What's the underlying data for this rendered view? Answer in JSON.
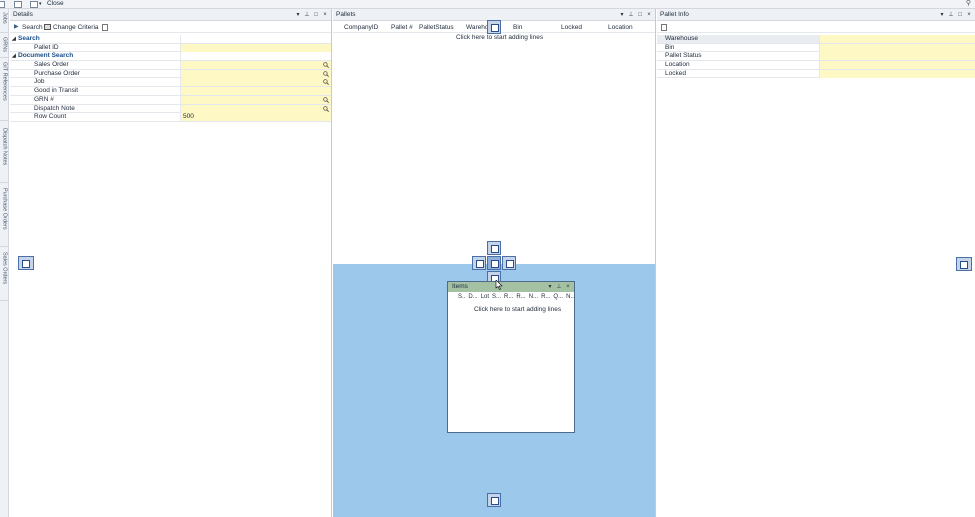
{
  "toolbar": {
    "close_label": "Close"
  },
  "side_tabs": [
    "Jobs",
    "GRNs",
    "GIT References",
    "Dispatch Notes",
    "Purchase Orders",
    "Sales Orders"
  ],
  "details": {
    "title": "Details",
    "search_label": "Search",
    "change_criteria_label": "Change Criteria",
    "cat_search": "Search",
    "cat_document": "Document Search",
    "rows": {
      "pallet_id": "Pallet ID",
      "sales_order": "Sales Order",
      "purchase_order": "Purchase Order",
      "job": "Job",
      "good_in_transit": "Good in Transit",
      "grn": "GRN #",
      "dispatch_note": "Dispatch Note",
      "row_count": "Row Count",
      "row_count_value": "500"
    }
  },
  "pallets": {
    "title": "Pallets",
    "columns": [
      "CompanyID",
      "Pallet #",
      "PalletStatus",
      "Wareho",
      "Bin",
      "Locked",
      "Location"
    ],
    "hint": "Click here to start adding lines"
  },
  "items": {
    "title": "Items",
    "columns": [
      "S..",
      "D...",
      "Lot",
      "S...",
      "R...",
      "R...",
      "N...",
      "R...",
      "Q...",
      "N..."
    ],
    "hint": "Click here to start adding lines"
  },
  "pallet_info": {
    "title": "Pallet Info",
    "rows": [
      "Warehouse",
      "Bin",
      "Pallet Status",
      "Location",
      "Locked"
    ]
  },
  "colors": {
    "dock_highlight": "#9cc8eb",
    "field_yellow": "#fdf8c4",
    "category_blue": "#1a4e8c"
  }
}
